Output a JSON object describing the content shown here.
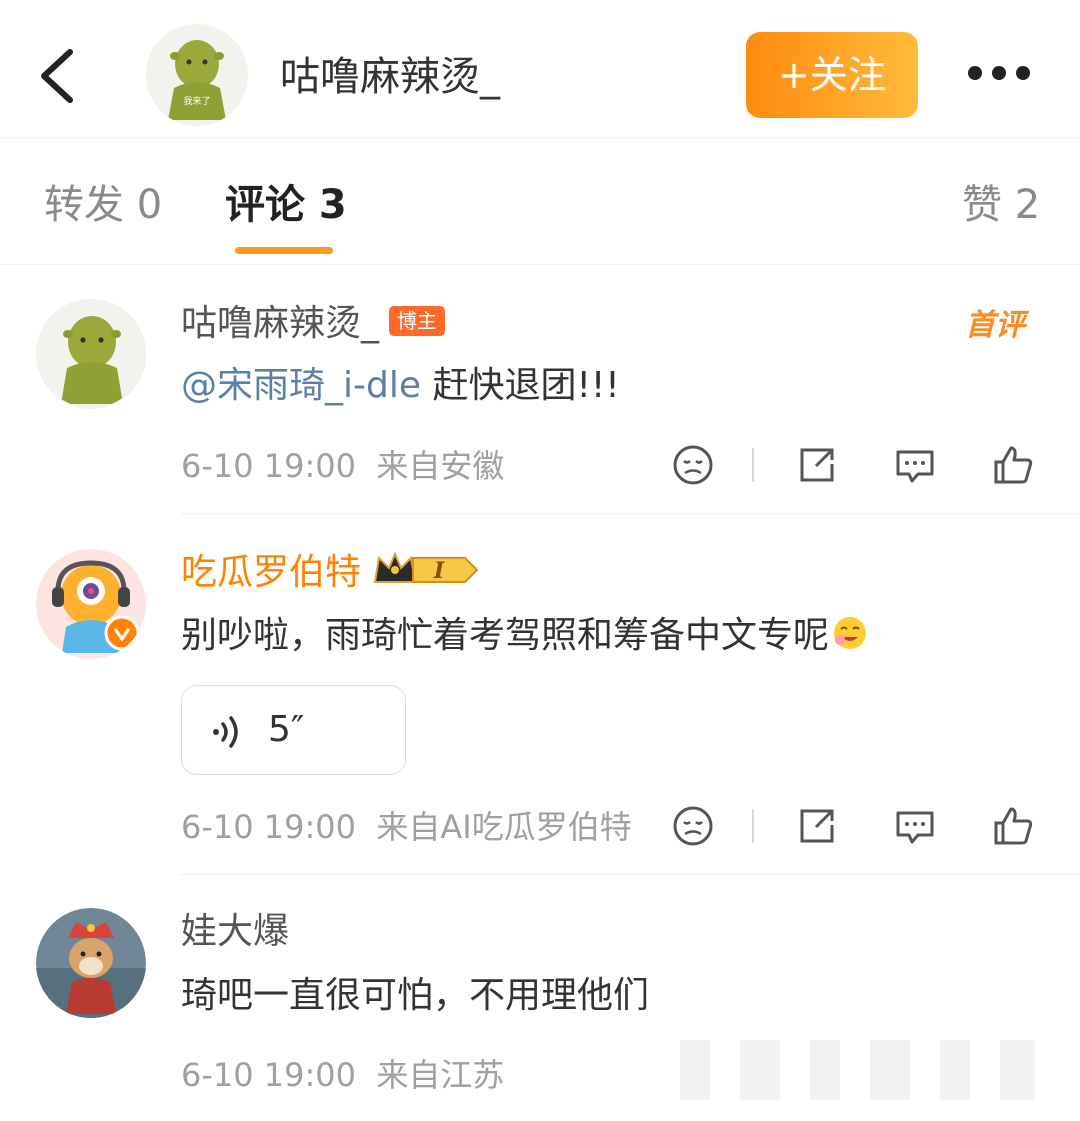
{
  "header": {
    "username": "咕噜麻辣烫_",
    "follow_label": "+关注",
    "avatar_caption": "我来了"
  },
  "tabs": {
    "repost": "转发 0",
    "comments": "评论 3",
    "likes": "赞 2"
  },
  "comments": [
    {
      "author": "咕噜麻辣烫_",
      "badge": "博主",
      "tag": "首评",
      "mention": "@宋雨琦_i-dle",
      "text": " 赶快退团!!!",
      "time": "6-10 19:00",
      "source": "来自安徽"
    },
    {
      "author": "吃瓜罗伯特",
      "vip_level": "I",
      "text": "别吵啦，雨琦忙着考驾照和筹备中文专呢",
      "voice_length": "5″",
      "time": "6-10 19:00",
      "source": "来自AI吃瓜罗伯特"
    },
    {
      "author": "娃大爆",
      "text": "琦吧一直很可怕，不用理他们",
      "time": "6-10 19:00",
      "source": "来自江苏"
    }
  ],
  "colors": {
    "accent": "#ff8b10",
    "mention": "#5b7fa6",
    "vip_name": "#ff8200"
  }
}
